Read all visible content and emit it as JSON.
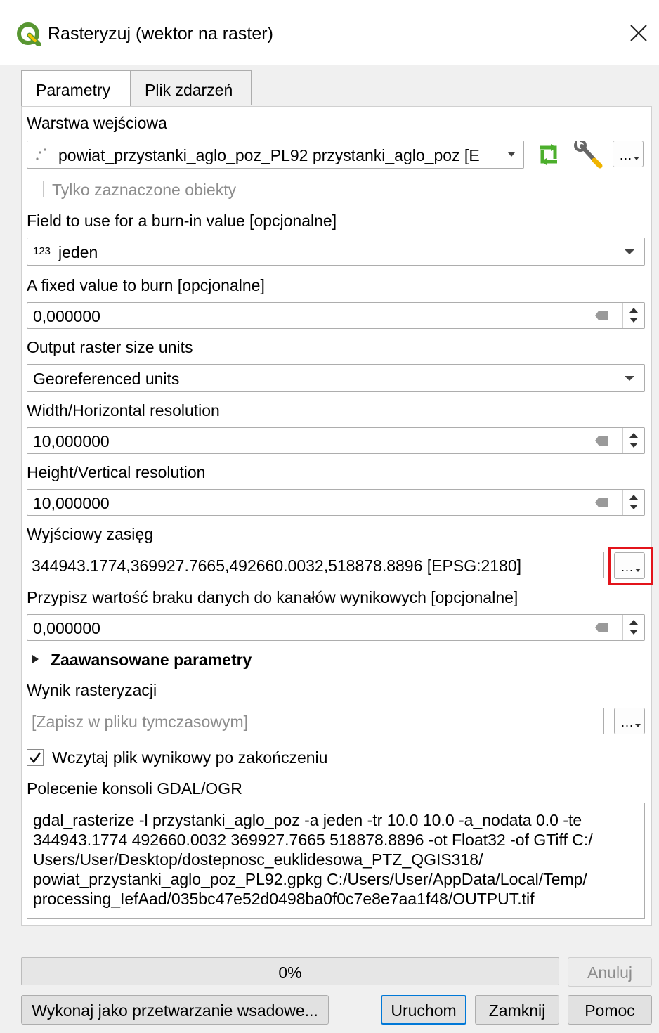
{
  "window": {
    "title": "Rasteryzuj (wektor na raster)"
  },
  "tabs": [
    {
      "label": "Parametry",
      "active": true
    },
    {
      "label": "Plik zdarzeń",
      "active": false
    }
  ],
  "input_layer": {
    "label": "Warstwa wejściowa",
    "value": "powiat_przystanki_aglo_poz_PL92 przystanki_aglo_poz [E",
    "selected_only_label": "Tylko zaznaczone obiekty"
  },
  "burn_field": {
    "label": "Field to use for a burn-in value [opcjonalne]",
    "type_badge": "123",
    "value": "jeden"
  },
  "fixed_value": {
    "label": "A fixed value to burn [opcjonalne]",
    "value": "0,000000"
  },
  "size_units": {
    "label": "Output raster size units",
    "value": "Georeferenced units"
  },
  "width": {
    "label": "Width/Horizontal resolution",
    "value": "10,000000"
  },
  "height": {
    "label": "Height/Vertical resolution",
    "value": "10,000000"
  },
  "extent": {
    "label": "Wyjściowy zasięg",
    "value": "344943.1774,369927.7665,492660.0032,518878.8896 [EPSG:2180]"
  },
  "nodata": {
    "label": "Przypisz wartość braku danych do kanałów wynikowych [opcjonalne]",
    "value": "0,000000"
  },
  "advanced": {
    "label": "Zaawansowane parametry"
  },
  "output": {
    "label": "Wynik rasteryzacji",
    "placeholder": "[Zapisz w pliku tymczasowym]"
  },
  "load_result": {
    "label": "Wczytaj plik wynikowy po zakończeniu",
    "checked": true
  },
  "console": {
    "label": "Polecenie konsoli GDAL/OGR",
    "lines": [
      "gdal_rasterize -l przystanki_aglo_poz -a jeden -tr 10.0 10.0 -a_nodata 0.0 -te",
      "344943.1774 492660.0032 369927.7665 518878.8896 -ot Float32 -of GTiff C:/",
      "Users/User/Desktop/dostepnosc_euklidesowa_PTZ_QGIS318/",
      "powiat_przystanki_aglo_poz_PL92.gpkg C:/Users/User/AppData/Local/Temp/",
      "processing_IefAad/035bc47e52d0498ba0f0c7e8e7aa1f48/OUTPUT.tif"
    ]
  },
  "progress": {
    "value": 0.0,
    "text": "0%"
  },
  "buttons": {
    "cancel": "Anuluj",
    "batch": "Wykonaj jako przetwarzanie wsadowe...",
    "run": "Uruchom",
    "close": "Zamknij",
    "help": "Pomoc",
    "dots": "..."
  },
  "colors": {
    "highlight_box": "#e3141b",
    "qgis_green": "#589632",
    "qgis_yellow": "#f0c400"
  }
}
